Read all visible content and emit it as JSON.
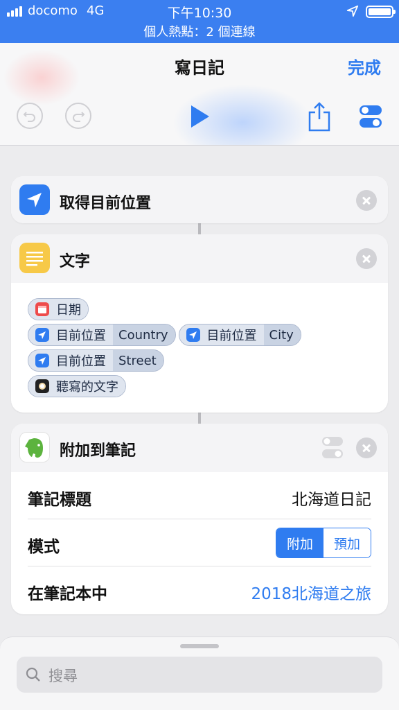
{
  "status_bar": {
    "carrier": "docomo",
    "network": "4G",
    "time": "下午10:30",
    "hotspot": "個人熱點：2 個連線"
  },
  "nav": {
    "title": "寫日記",
    "done_label": "完成"
  },
  "actions": [
    {
      "title": "取得目前位置",
      "icon": "location-arrow-icon",
      "color": "#2f7cf0"
    },
    {
      "title": "文字",
      "icon": "text-lines-icon",
      "color": "#f7c948",
      "tokens": [
        {
          "label": "日期",
          "icon": "calendar-icon"
        },
        {
          "label": "目前位置",
          "sub": "Country",
          "icon": "location-arrow-icon"
        },
        {
          "label": "目前位置",
          "sub": "City",
          "icon": "location-arrow-icon"
        },
        {
          "label": "目前位置",
          "sub": "Street",
          "icon": "location-arrow-icon"
        },
        {
          "label": "聽寫的文字",
          "icon": "dictation-icon"
        }
      ]
    },
    {
      "title": "附加到筆記",
      "icon": "evernote-elephant-icon",
      "color": "#5cb33e",
      "params": {
        "note_title_label": "筆記標題",
        "note_title_value": "北海道日記",
        "mode_label": "模式",
        "mode_options": [
          "附加",
          "預加"
        ],
        "mode_selected": "附加",
        "notebook_label": "在筆記本中",
        "notebook_value": "2018北海道之旅"
      }
    }
  ],
  "search": {
    "placeholder": "搜尋"
  }
}
